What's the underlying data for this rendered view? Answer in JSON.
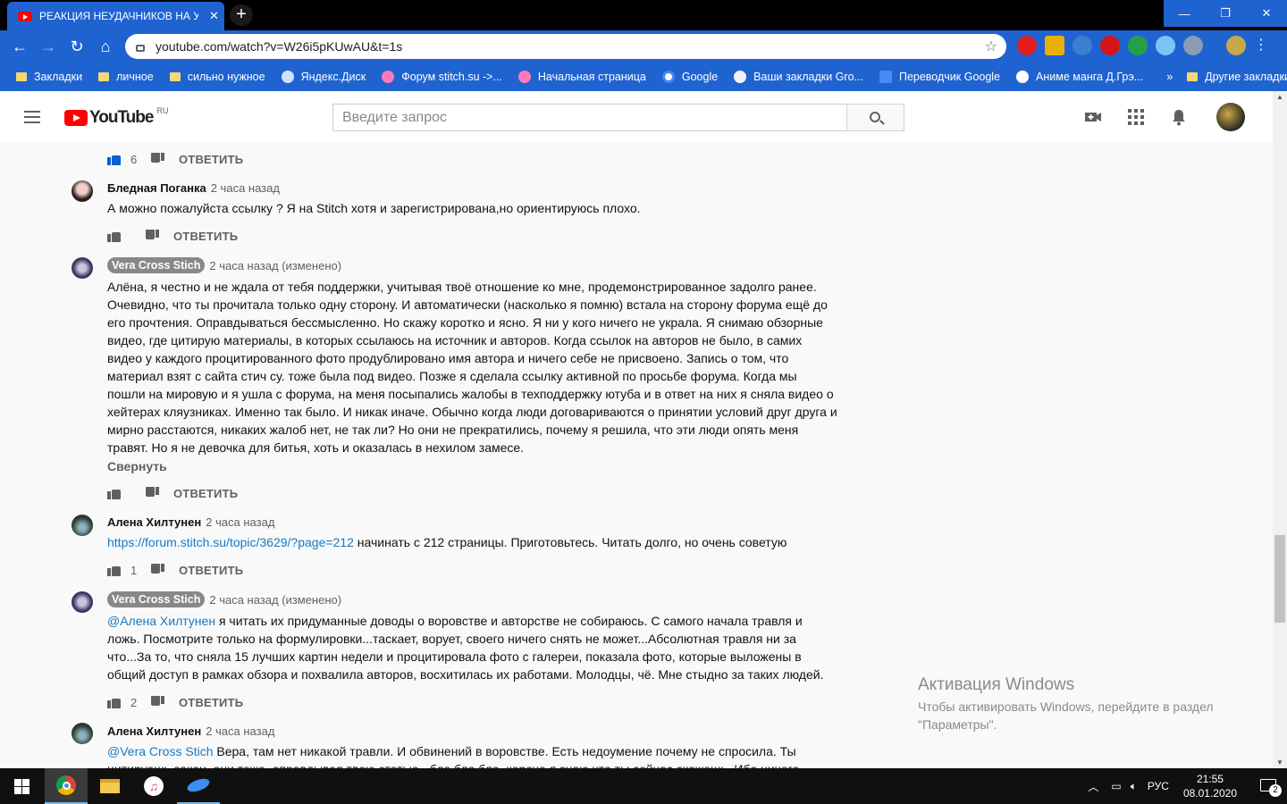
{
  "browser": {
    "tab_title": "РЕАКЦИЯ НЕУДАЧНИКОВ НА УС",
    "url": "youtube.com/watch?v=W26i5pKUwAU&t=1s",
    "bookmarks": [
      {
        "label": "Закладки",
        "icon": "folder"
      },
      {
        "label": "личное",
        "icon": "folder"
      },
      {
        "label": "сильно нужное",
        "icon": "folder"
      },
      {
        "label": "Яндекс.Диск",
        "icon": "yandex-disk"
      },
      {
        "label": "Форум stitch.su ->...",
        "icon": "stitch"
      },
      {
        "label": "Начальная страница",
        "icon": "stitch"
      },
      {
        "label": "Google",
        "icon": "google"
      },
      {
        "label": "Ваши закладки Gro...",
        "icon": "grouple"
      },
      {
        "label": "Переводчик Google",
        "icon": "translate"
      },
      {
        "label": "Аниме манга Д.Грэ...",
        "icon": "anime"
      }
    ],
    "bookmarks_more": "»",
    "other_bookmarks": "Другие закладки"
  },
  "youtube": {
    "logo_text": "YouTube",
    "region": "RU",
    "search_placeholder": "Введите запрос"
  },
  "comments": [
    {
      "id": "c0",
      "author": "",
      "time": "",
      "text": "",
      "likes": "6",
      "reply": "ОТВЕТИТЬ"
    },
    {
      "id": "c1",
      "author": "Бледная Поганка",
      "badge": false,
      "time": "2 часа назад",
      "text": "А можно пожалуйста ссылку ? Я на Stitch хотя и зарегистрирована,но ориентируюсь плохо.",
      "likes": "",
      "reply": "ОТВЕТИТЬ"
    },
    {
      "id": "c2",
      "author": "Vera Cross Stich",
      "badge": true,
      "time": "2 часа назад (изменено)",
      "text": "Алёна, я честно и не ждала от тебя поддержки, учитывая твоё отношение ко мне, продемонстрированное задолго ранее. Очевидно, что ты прочитала только одну сторону. И автоматически (насколько я помню) встала на сторону форума ещё до его прочтения. Оправдываться бессмысленно. Но скажу коротко и ясно. Я ни у кого ничего не украла. Я снимаю обзорные видео, где цитирую материалы, в которых ссылаюсь на источник и авторов. Когда ссылок на авторов не было, в самих видео у каждого процитированного фото продублировано имя автора и ничего себе не присвоено. Запись о том, что материал взят с сайта стич су. тоже была под видео. Позже я сделала ссылку активной по просьбе форума.  Когда мы пошли на мировую и я ушла с форума, на меня посыпались жалобы в техподдержку ютуба и в ответ на них я сняла видео о хейтерах кляузниках. Именно так было. И никак иначе. Обычно когда люди договариваются о принятии условий друг друга и мирно расстаются, никаких жалоб нет, не так ли? Но они не прекратились, почему я решила, что эти люди опять меня травят. Но я не девочка для битья, хоть и оказалась в нехилом замесе.",
      "collapse": "Свернуть",
      "likes": "",
      "reply": "ОТВЕТИТЬ"
    },
    {
      "id": "c3",
      "author": "Алена Хилтунен",
      "badge": false,
      "time": "2 часа назад",
      "link": "https://forum.stitch.su/topic/3629/?page=212",
      "text": " начинать с 212 страницы. Приготовьтесь. Читать долго, но очень советую",
      "likes": "1",
      "reply": "ОТВЕТИТЬ"
    },
    {
      "id": "c4",
      "author": "Vera Cross Stich",
      "badge": true,
      "time": "2 часа назад (изменено)",
      "mention": "@Алена Хилтунен",
      "text": " я читать их придуманные доводы о воровстве и авторстве не собираюсь. С самого начала травля и ложь. Посмотрите только на формулировки...таскает, ворует, своего ничего снять не может...Абсолютная травля ни за что...За то, что сняла 15 лучших картин недели и процитировала фото с галереи, показала фото, которые выложены в общий доступ в рамках обзора и похвалила авторов, восхитилась их работами. Молодцы, чё. Мне стыдно за таких людей.",
      "likes": "2",
      "reply": "ОТВЕТИТЬ"
    },
    {
      "id": "c5",
      "author": "Алена Хилтунен",
      "badge": false,
      "time": "2 часа назад",
      "mention": "@Vera Cross Stich",
      "text": " Вера, там нет никакой травли. И обвинений в воровстве. Есть недоумение почему не спросила. Ты цитируешь закон, они тоже, оправдывая твою статью - бла бла бла, короче я знаю что ты сейчас скажешь. Ибо ничего"
    }
  ],
  "windows_activation": {
    "title": "Активация Windows",
    "line1": "Чтобы активировать Windows, перейдите в раздел",
    "line2": "\"Параметры\"."
  },
  "taskbar": {
    "lang": "РУС",
    "time": "21:55",
    "date": "08.01.2020",
    "notifications": "2"
  }
}
